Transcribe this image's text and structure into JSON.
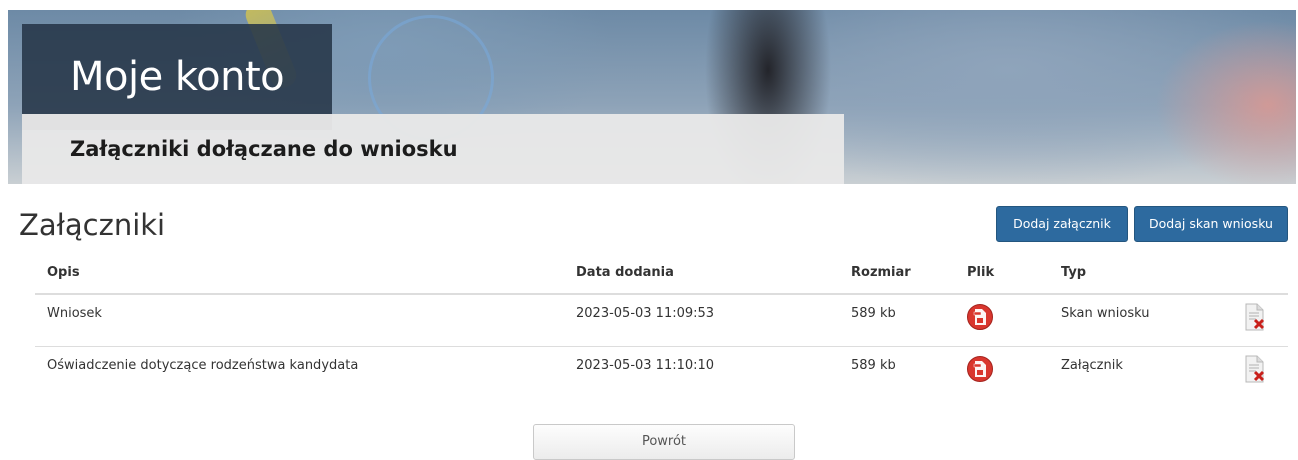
{
  "banner": {
    "title": "Moje konto",
    "subtitle": "Załączniki dołączane do wniosku"
  },
  "section": {
    "heading": "Załączniki",
    "add_attachment_label": "Dodaj załącznik",
    "add_scan_label": "Dodaj skan wniosku"
  },
  "table": {
    "headers": {
      "opis": "Opis",
      "data": "Data dodania",
      "rozmiar": "Rozmiar",
      "plik": "Plik",
      "typ": "Typ"
    },
    "rows": [
      {
        "opis": "Wniosek",
        "data": "2023-05-03 11:09:53",
        "rozmiar": "589 kb",
        "plik_icon": "pdf-icon",
        "typ": "Skan wniosku",
        "action_icon": "delete-document-icon"
      },
      {
        "opis": "Oświadczenie dotyczące rodzeństwa kandydata",
        "data": "2023-05-03 11:10:10",
        "rozmiar": "589 kb",
        "plik_icon": "pdf-icon",
        "typ": "Załącznik",
        "action_icon": "delete-document-icon"
      }
    ]
  },
  "footer": {
    "back_label": "Powrót"
  },
  "colors": {
    "primary_button": "#2d6a9f",
    "pdf_icon": "#d9362e",
    "delete_icon": "#c8201b"
  }
}
